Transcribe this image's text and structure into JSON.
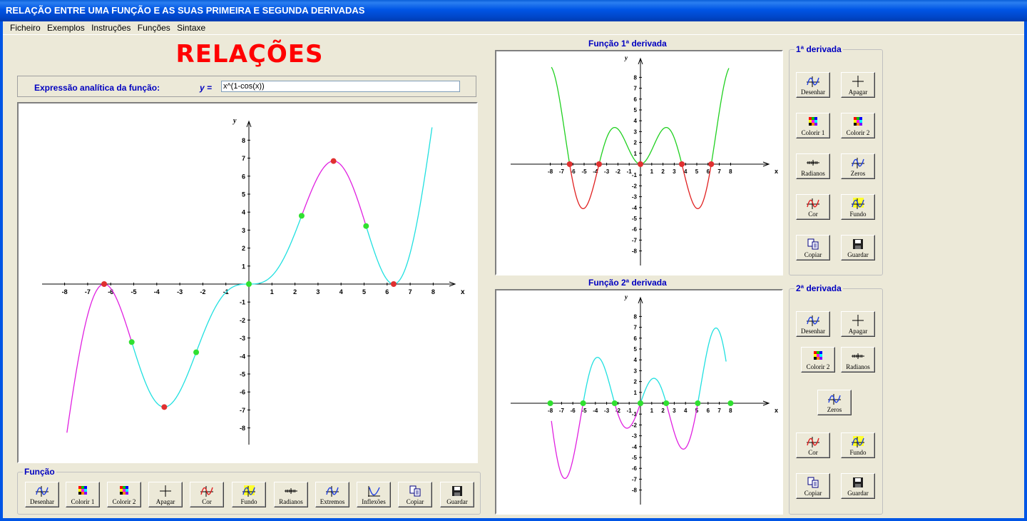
{
  "window": {
    "title": "RELAÇÃO ENTRE UMA FUNÇÃO E AS SUAS PRIMEIRA E SEGUNDA DERIVADAS"
  },
  "menu": [
    "Ficheiro",
    "Exemplos",
    "Instruções",
    "Funções",
    "Sintaxe"
  ],
  "heading": "RELAÇÕES",
  "expression": {
    "label": "Expressão analítica da função:",
    "y_label": "y =",
    "value": "x^(1-cos(x))"
  },
  "main_plot": {
    "x_axis_label": "x",
    "y_axis_label": "y",
    "x_ticks": [
      "-8",
      "-7",
      "-6",
      "-5",
      "-4",
      "-3",
      "-2",
      "-1",
      "1",
      "2",
      "3",
      "4",
      "5",
      "6",
      "7",
      "8"
    ],
    "y_ticks": [
      "8",
      "7",
      "6",
      "5",
      "4",
      "3",
      "2",
      "1",
      "-1",
      "-2",
      "-3",
      "-4",
      "-5",
      "-6",
      "-7",
      "-8"
    ]
  },
  "deriv1": {
    "heading": "Função  1ª derivada",
    "x_axis_label": "x",
    "y_axis_label": "y",
    "x_ticks": [
      "-8",
      "-7",
      "-6",
      "-5",
      "-4",
      "-3",
      "-2",
      "-1",
      "1",
      "2",
      "3",
      "4",
      "5",
      "6",
      "7",
      "8"
    ],
    "y_ticks": [
      "8",
      "7",
      "6",
      "5",
      "4",
      "3",
      "2",
      "1",
      "-1",
      "-2",
      "-3",
      "-4",
      "-5",
      "-6",
      "-7",
      "-8"
    ]
  },
  "deriv2": {
    "heading": "Função  2ª derivada",
    "x_axis_label": "x",
    "y_axis_label": "y",
    "x_ticks": [
      "-8",
      "-7",
      "-6",
      "-5",
      "-4",
      "-3",
      "-2",
      "-1",
      "1",
      "2",
      "3",
      "4",
      "5",
      "6",
      "7",
      "8"
    ],
    "y_ticks": [
      "8",
      "7",
      "6",
      "5",
      "4",
      "3",
      "2",
      "1",
      "-1",
      "-2",
      "-3",
      "-4",
      "-5",
      "-6",
      "-7",
      "-8"
    ]
  },
  "funcao_panel": {
    "title": "Função",
    "buttons": [
      {
        "label": "Desenhar",
        "icon": "draw-icon"
      },
      {
        "label": "Colorir 1",
        "icon": "palette-icon"
      },
      {
        "label": "Colorir 2",
        "icon": "palette-icon"
      },
      {
        "label": "Apagar",
        "icon": "cross-icon"
      },
      {
        "label": "Cor",
        "icon": "curve-color-icon"
      },
      {
        "label": "Fundo",
        "icon": "background-icon"
      },
      {
        "label": "Radianos",
        "icon": "radians-icon"
      },
      {
        "label": "Extremos",
        "icon": "extremes-icon"
      },
      {
        "label": "Inflexões",
        "icon": "inflections-icon"
      },
      {
        "label": "Copiar",
        "icon": "copy-icon"
      },
      {
        "label": "Guardar",
        "icon": "save-icon"
      }
    ]
  },
  "deriv1_panel": {
    "title": "1ª derivada",
    "buttons": [
      {
        "label": "Desenhar",
        "icon": "draw-icon"
      },
      {
        "label": "Apagar",
        "icon": "cross-icon"
      },
      {
        "label": "Colorir 1",
        "icon": "palette-icon"
      },
      {
        "label": "Colorir 2",
        "icon": "palette-icon"
      },
      {
        "label": "Radianos",
        "icon": "radians-icon"
      },
      {
        "label": "Zeros",
        "icon": "zeros-icon"
      },
      {
        "label": "Cor",
        "icon": "curve-color-icon"
      },
      {
        "label": "Fundo",
        "icon": "background-icon"
      },
      {
        "label": "Copiar",
        "icon": "copy-icon"
      },
      {
        "label": "Guardar",
        "icon": "save-icon"
      }
    ]
  },
  "deriv2_panel": {
    "title": "2ª derivada",
    "buttons": [
      {
        "label": "Desenhar",
        "icon": "draw-icon"
      },
      {
        "label": "Apagar",
        "icon": "cross-icon"
      },
      {
        "label": "Colorir 2",
        "icon": "palette-icon"
      },
      {
        "label": "Radianos",
        "icon": "radians-icon"
      },
      {
        "label": "Zeros",
        "icon": "zeros-icon"
      },
      {
        "label": "Cor",
        "icon": "curve-color-icon"
      },
      {
        "label": "Fundo",
        "icon": "background-icon"
      },
      {
        "label": "Copiar",
        "icon": "copy-icon"
      },
      {
        "label": "Guardar",
        "icon": "save-icon"
      }
    ]
  },
  "colors": {
    "title_blue": "#0000c0",
    "heading_red": "#ff0000",
    "magenta": "#e020e0",
    "cyan": "#20e0e0",
    "green": "#20d020",
    "red": "#e02020",
    "green_point": "#30e030",
    "red_point": "#e03030"
  }
}
